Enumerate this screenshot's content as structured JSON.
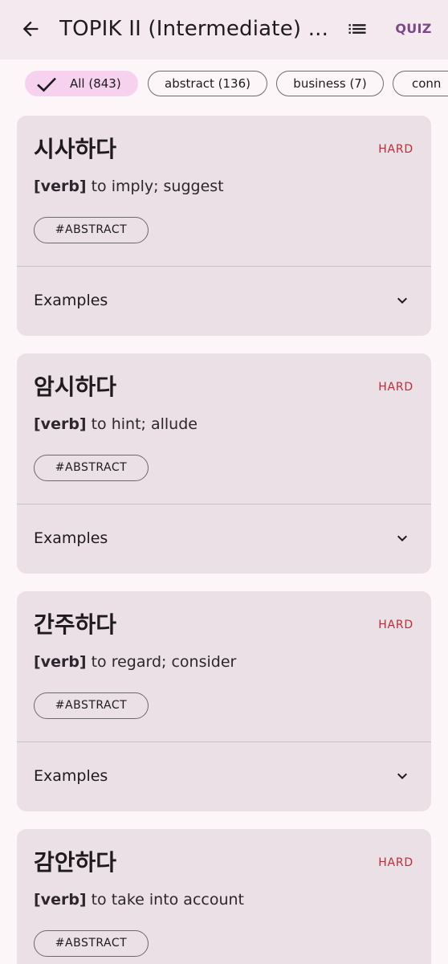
{
  "appbar": {
    "title": "TOPIK II (Intermediate) ...",
    "quiz_label": "QUIZ",
    "back_icon": "arrow-back-icon",
    "list_icon": "list-icon"
  },
  "filters": [
    {
      "label": "All (843)",
      "selected": true
    },
    {
      "label": "abstract (136)",
      "selected": false
    },
    {
      "label": "business (7)",
      "selected": false
    },
    {
      "label": "conn",
      "selected": false
    }
  ],
  "cards": [
    {
      "word": "시사하다",
      "level": "HARD",
      "pos": "[verb]",
      "meaning": "to imply; suggest",
      "tag": "#ABSTRACT",
      "examples_label": "Examples"
    },
    {
      "word": "암시하다",
      "level": "HARD",
      "pos": "[verb]",
      "meaning": "to hint; allude",
      "tag": "#ABSTRACT",
      "examples_label": "Examples"
    },
    {
      "word": "간주하다",
      "level": "HARD",
      "pos": "[verb]",
      "meaning": "to regard; consider",
      "tag": "#ABSTRACT",
      "examples_label": "Examples"
    },
    {
      "word": "감안하다",
      "level": "HARD",
      "pos": "[verb]",
      "meaning": "to take into account",
      "tag": "#ABSTRACT",
      "examples_label": "Examples"
    }
  ],
  "colors": {
    "background": "#fdf6f9",
    "appbar": "#f3e9ef",
    "card": "#eae0e6",
    "selected_chip": "#f7d2ef",
    "hard": "#ba2f38",
    "accent": "#7b4a86"
  }
}
